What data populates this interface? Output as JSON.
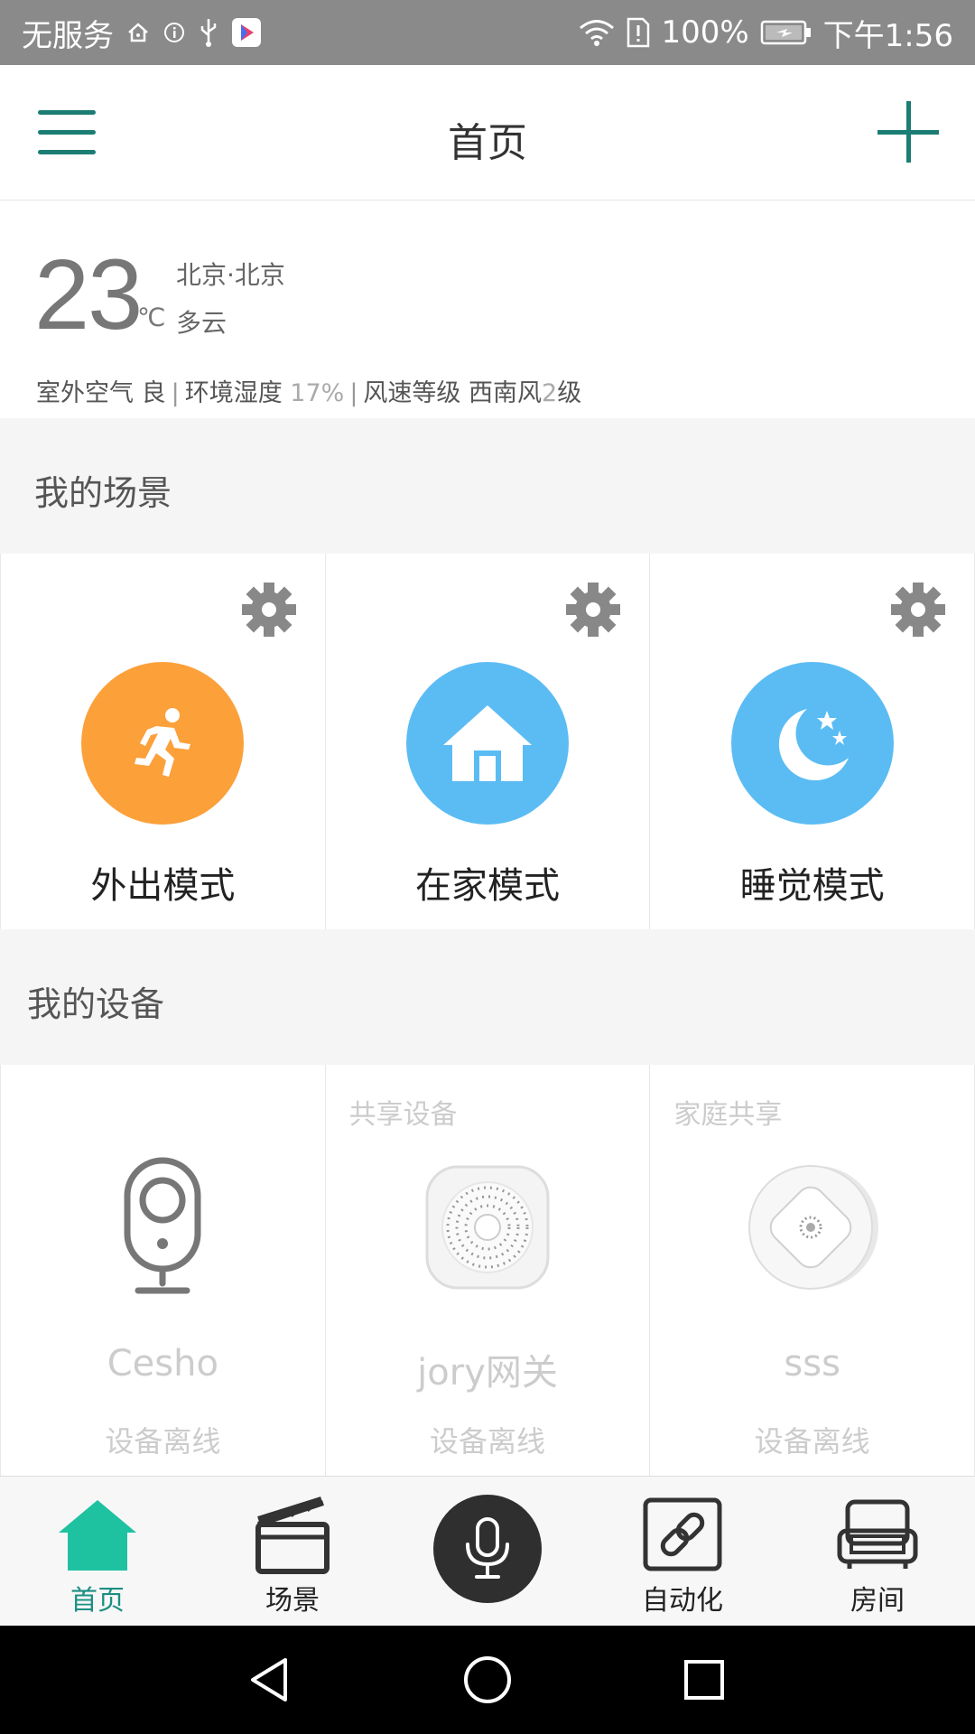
{
  "status_bar": {
    "carrier": "无服务",
    "battery": "100%",
    "time": "下午1:56"
  },
  "header": {
    "title": "首页",
    "menu_icon": "hamburger-menu-icon",
    "add_icon": "plus-icon"
  },
  "weather": {
    "temperature": "23",
    "unit": "℃",
    "city": "北京·北京",
    "condition": "多云",
    "air_label": "室外空气",
    "air_value": "良",
    "humidity_label": "环境湿度",
    "humidity_value": "17%",
    "wind_label": "风速等级",
    "wind_dir": "西南风",
    "wind_level": "2",
    "wind_unit": "级",
    "separator": "|"
  },
  "scenes": {
    "title": "我的场景",
    "items": [
      {
        "label": "外出模式",
        "icon": "running-person-icon",
        "color": "#fca03a"
      },
      {
        "label": "在家模式",
        "icon": "house-icon",
        "color": "#5bbcf4"
      },
      {
        "label": "睡觉模式",
        "icon": "moon-stars-icon",
        "color": "#5bbcf4"
      }
    ]
  },
  "devices": {
    "title": "我的设备",
    "items": [
      {
        "tag": "",
        "name": "Cesho",
        "status": "设备离线",
        "icon": "camera-icon"
      },
      {
        "tag": "共享设备",
        "name": "jory网关",
        "status": "设备离线",
        "icon": "gateway-icon"
      },
      {
        "tag": "家庭共享",
        "name": "sss",
        "status": "设备离线",
        "icon": "smoke-detector-icon"
      }
    ]
  },
  "bottom_nav": {
    "items": [
      {
        "label": "首页",
        "icon": "home-icon",
        "active": true
      },
      {
        "label": "场景",
        "icon": "clapperboard-icon",
        "active": false
      },
      {
        "label": "",
        "icon": "microphone-icon",
        "active": false
      },
      {
        "label": "自动化",
        "icon": "link-icon",
        "active": false
      },
      {
        "label": "房间",
        "icon": "sofa-icon",
        "active": false
      }
    ]
  },
  "colors": {
    "accent": "#1b7d73",
    "active_nav": "#1b8f83",
    "orange": "#fca03a",
    "blue": "#5bbcf4"
  }
}
